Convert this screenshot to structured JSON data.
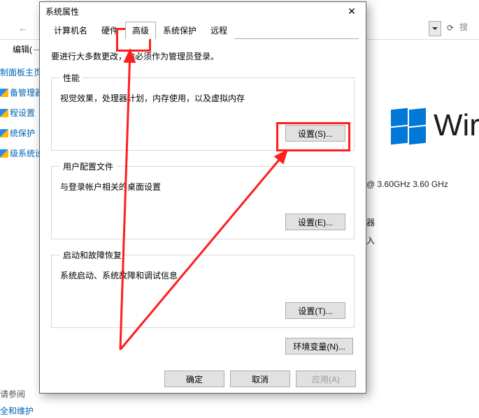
{
  "background": {
    "edit_label": "编辑(",
    "left_links": [
      "制面板主页",
      "备管理器",
      "程设置",
      "统保护",
      "级系统设置"
    ],
    "related_heading": "请参阅",
    "related_link": "全和维护",
    "win_label": "Wir",
    "cpu_text": "@ 3.60GHz   3.60 GHz",
    "label_device": "器",
    "label_input": "入",
    "search_placeholder": "搜"
  },
  "dialog": {
    "title": "系统属性",
    "tabs": {
      "computer_name": "计算机名",
      "hardware": "硬件",
      "advanced": "高级",
      "system_protection": "系统保护",
      "remote": "远程"
    },
    "notice": "要进行大多数更改，你必须作为管理员登录。",
    "performance": {
      "legend": "性能",
      "desc": "视觉效果，处理器计划，内存使用，以及虚拟内存",
      "button": "设置(S)..."
    },
    "user_profiles": {
      "legend": "用户配置文件",
      "desc": "与登录帐户相关的桌面设置",
      "button": "设置(E)..."
    },
    "startup": {
      "legend": "启动和故障恢复",
      "desc": "系统启动、系统故障和调试信息",
      "button": "设置(T)..."
    },
    "env_button": "环境变量(N)...",
    "ok": "确定",
    "cancel": "取消",
    "apply": "应用(A)"
  }
}
